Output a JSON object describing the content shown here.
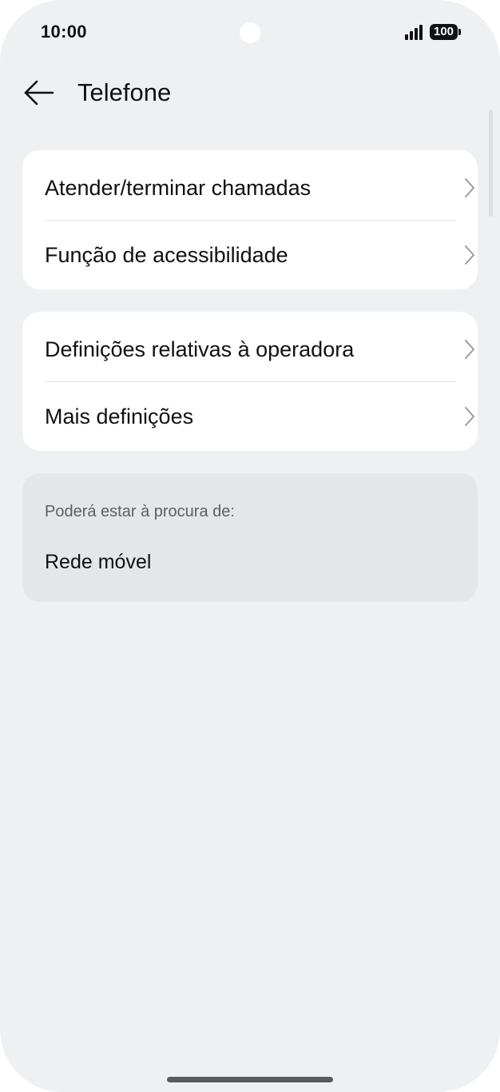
{
  "status_bar": {
    "time": "10:00",
    "battery": "100"
  },
  "header": {
    "title": "Telefone",
    "back_icon": "arrow-left-icon"
  },
  "groups": [
    {
      "items": [
        {
          "label": "Atender/terminar chamadas",
          "icon": "chevron-right-icon"
        },
        {
          "label": "Função de acessibilidade",
          "icon": "chevron-right-icon"
        }
      ]
    },
    {
      "items": [
        {
          "label": "Definições relativas à operadora",
          "icon": "chevron-right-icon"
        },
        {
          "label": "Mais definições",
          "icon": "chevron-right-icon"
        }
      ]
    }
  ],
  "suggestions": {
    "heading": "Poderá estar à procura de:",
    "items": [
      "Rede móvel"
    ]
  }
}
